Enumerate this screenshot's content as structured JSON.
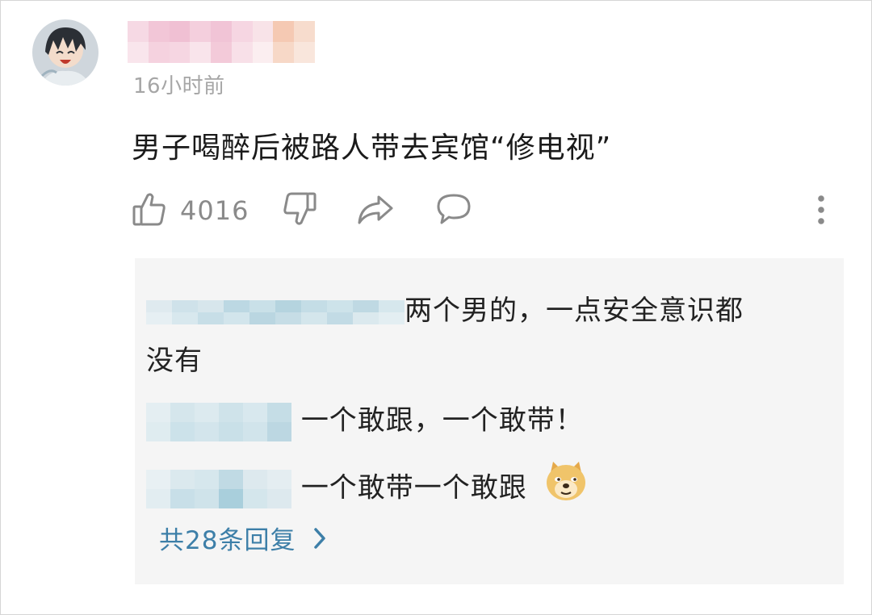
{
  "comment": {
    "timestamp": "16小时前",
    "text": "男子喝醉后被路人带去宾馆“修电视”",
    "like_count": "4016"
  },
  "replies": [
    {
      "text": "两个男的，一点安全意识都",
      "text_cont": "没有"
    },
    {
      "text": "一个敢跟，一个敢带！"
    },
    {
      "text": "一个敢带一个敢跟"
    }
  ],
  "more_replies_label": "共28条回复",
  "icons": {
    "like": "thumbs-up-icon",
    "dislike": "thumbs-down-icon",
    "share": "share-icon",
    "comment": "comment-bubble-icon",
    "more": "more-vertical-icon",
    "emoji": "doge-emoji-icon",
    "chevron": "chevron-right-icon"
  },
  "colors": {
    "link": "#3d7fa8",
    "timestamp": "#a6a6a6",
    "reply_bg": "#f5f5f5"
  }
}
